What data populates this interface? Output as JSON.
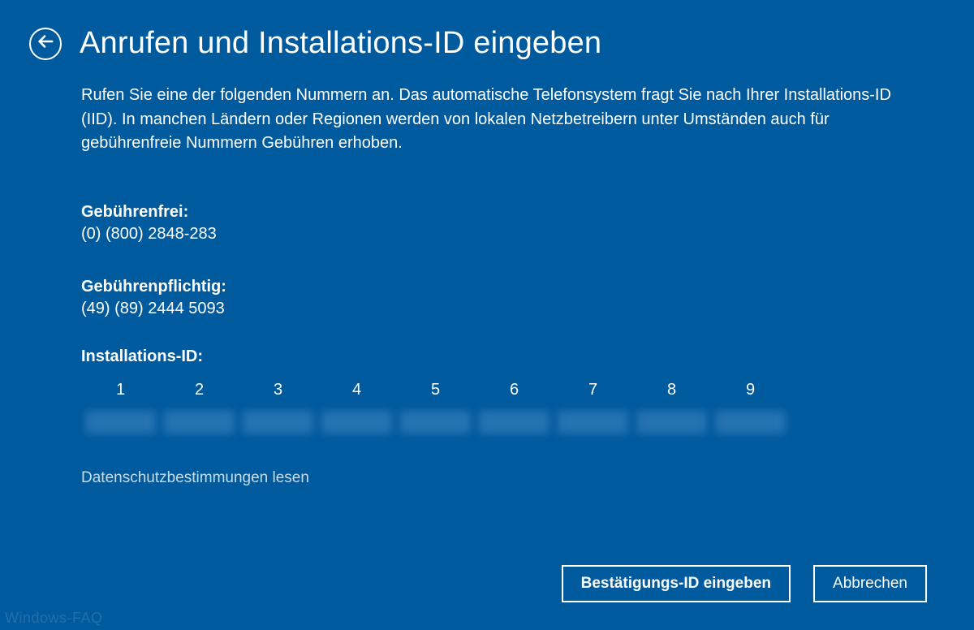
{
  "header": {
    "title": "Anrufen und Installations-ID eingeben"
  },
  "instructions": "Rufen Sie eine der folgenden Nummern an. Das automatische Telefonsystem fragt Sie nach Ihrer Installations-ID (IID). In manchen Ländern oder Regionen werden von lokalen Netzbetreibern unter Umständen auch für gebührenfreie Nummern Gebühren erhoben.",
  "tollfree": {
    "label": "Gebührenfrei:",
    "number": "(0) (800) 2848-283"
  },
  "toll": {
    "label": "Gebührenpflichtig:",
    "number": "(49) (89) 2444 5093"
  },
  "installation": {
    "label": "Installations-ID:",
    "columns": [
      "1",
      "2",
      "3",
      "4",
      "5",
      "6",
      "7",
      "8",
      "9"
    ]
  },
  "privacy_link": "Datenschutzbestimmungen lesen",
  "buttons": {
    "confirm": "Bestätigungs-ID eingeben",
    "cancel": "Abbrechen"
  },
  "watermark": "Windows-FAQ"
}
